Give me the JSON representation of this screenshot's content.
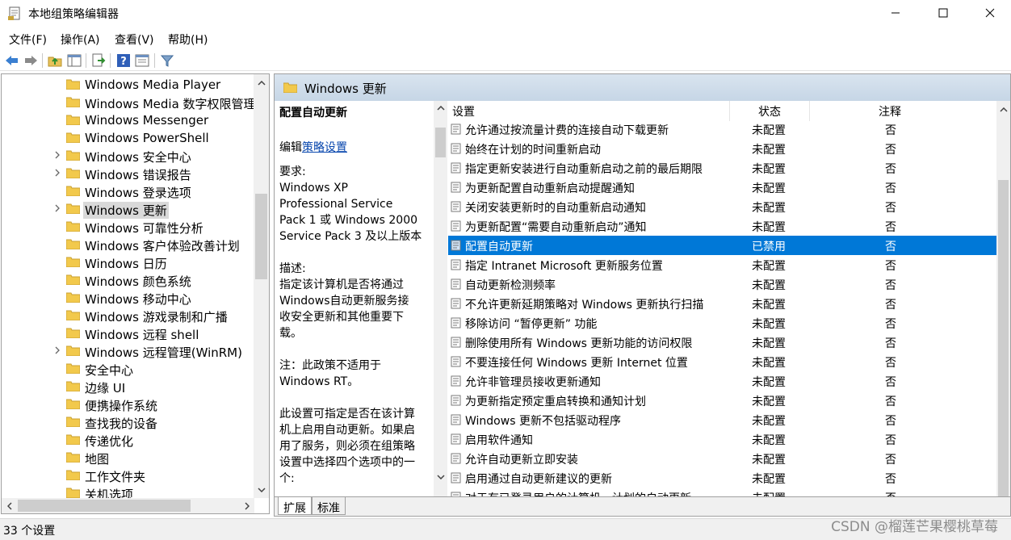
{
  "window": {
    "title": "本地组策略编辑器"
  },
  "menu": [
    "文件(F)",
    "操作(A)",
    "查看(V)",
    "帮助(H)"
  ],
  "toolbar_icons": [
    "back-arrow-icon",
    "forward-arrow-icon",
    "up-folder-icon",
    "show-hide-tree-icon",
    "export-list-icon",
    "help-icon",
    "properties-icon",
    "filter-icon"
  ],
  "tree": {
    "items": [
      {
        "label": "Windows Media Player",
        "expandable": false
      },
      {
        "label": "Windows Media 数字权限管理",
        "expandable": false
      },
      {
        "label": "Windows Messenger",
        "expandable": false
      },
      {
        "label": "Windows PowerShell",
        "expandable": false
      },
      {
        "label": "Windows 安全中心",
        "expandable": true
      },
      {
        "label": "Windows 错误报告",
        "expandable": true
      },
      {
        "label": "Windows 登录选项",
        "expandable": false
      },
      {
        "label": "Windows 更新",
        "expandable": true,
        "selected": true
      },
      {
        "label": "Windows 可靠性分析",
        "expandable": false
      },
      {
        "label": "Windows 客户体验改善计划",
        "expandable": false
      },
      {
        "label": "Windows 日历",
        "expandable": false
      },
      {
        "label": "Windows 颜色系统",
        "expandable": false
      },
      {
        "label": "Windows 移动中心",
        "expandable": false
      },
      {
        "label": "Windows 游戏录制和广播",
        "expandable": false
      },
      {
        "label": "Windows 远程 shell",
        "expandable": false
      },
      {
        "label": "Windows 远程管理(WinRM)",
        "expandable": true
      },
      {
        "label": "安全中心",
        "expandable": false
      },
      {
        "label": "边缘 UI",
        "expandable": false
      },
      {
        "label": "便携操作系统",
        "expandable": false
      },
      {
        "label": "查找我的设备",
        "expandable": false
      },
      {
        "label": "传递优化",
        "expandable": false
      },
      {
        "label": "地图",
        "expandable": false
      },
      {
        "label": "工作文件夹",
        "expandable": false
      },
      {
        "label": "关机选项",
        "expandable": false
      }
    ]
  },
  "pane": {
    "header_title": "Windows 更新",
    "description": {
      "title": "配置自动更新",
      "edit_prefix": "编辑",
      "edit_link": "策略设置",
      "requirements": "要求:\nWindows XP\nProfessional Service\nPack 1 或 Windows 2000\nService Pack 3 及以上版本",
      "description": "描述:\n指定该计算机是否将通过\nWindows自动更新服务接\n收安全更新和其他重要下\n载。",
      "note": "注：此政策不适用于\nWindows RT。",
      "extra": "此设置可指定是否在该计算\n机上启用自动更新。如果启\n用了服务，则必须在组策略\n设置中选择四个选项中的一\n个:"
    },
    "columns": {
      "setting": "设置",
      "state": "状态",
      "comment": "注释"
    },
    "rows": [
      {
        "name": "允许通过按流量计费的连接自动下载更新",
        "state": "未配置",
        "comment": "否"
      },
      {
        "name": "始终在计划的时间重新启动",
        "state": "未配置",
        "comment": "否"
      },
      {
        "name": "指定更新安装进行自动重新启动之前的最后期限",
        "state": "未配置",
        "comment": "否"
      },
      {
        "name": "为更新配置自动重新启动提醒通知",
        "state": "未配置",
        "comment": "否"
      },
      {
        "name": "关闭安装更新时的自动重新启动通知",
        "state": "未配置",
        "comment": "否"
      },
      {
        "name": "为更新配置“需要自动重新启动”通知",
        "state": "未配置",
        "comment": "否"
      },
      {
        "name": "配置自动更新",
        "state": "已禁用",
        "comment": "否",
        "selected": true
      },
      {
        "name": "指定 Intranet Microsoft 更新服务位置",
        "state": "未配置",
        "comment": "否"
      },
      {
        "name": "自动更新检测频率",
        "state": "未配置",
        "comment": "否"
      },
      {
        "name": "不允许更新延期策略对 Windows 更新执行扫描",
        "state": "未配置",
        "comment": "否"
      },
      {
        "name": "移除访问 “暂停更新” 功能",
        "state": "未配置",
        "comment": "否"
      },
      {
        "name": "删除使用所有 Windows 更新功能的访问权限",
        "state": "未配置",
        "comment": "否"
      },
      {
        "name": "不要连接任何 Windows 更新 Internet 位置",
        "state": "未配置",
        "comment": "否"
      },
      {
        "name": "允许非管理员接收更新通知",
        "state": "未配置",
        "comment": "否"
      },
      {
        "name": "为更新指定预定重启转换和通知计划",
        "state": "未配置",
        "comment": "否"
      },
      {
        "name": "Windows 更新不包括驱动程序",
        "state": "未配置",
        "comment": "否"
      },
      {
        "name": "启用软件通知",
        "state": "未配置",
        "comment": "否"
      },
      {
        "name": "允许自动更新立即安装",
        "state": "未配置",
        "comment": "否"
      },
      {
        "name": "启用通过自动更新建议的更新",
        "state": "未配置",
        "comment": "否"
      },
      {
        "name": "对于有已登录用户的计算机，计划的自动更新",
        "state": "未配置",
        "comment": "否"
      }
    ],
    "tabs": [
      "扩展",
      "标准"
    ]
  },
  "status": "33 个设置",
  "watermark": "CSDN @榴莲芒果樱桃草莓"
}
